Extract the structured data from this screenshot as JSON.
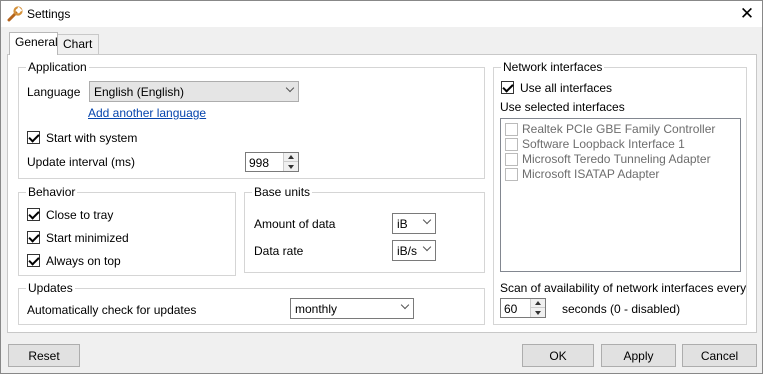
{
  "window": {
    "title": "Settings",
    "close_glyph": "✕"
  },
  "tabs": [
    {
      "label": "General",
      "active": true
    },
    {
      "label": "Chart",
      "active": false
    }
  ],
  "application": {
    "group_label": "Application",
    "language_label": "Language",
    "language_value": "English (English)",
    "add_language_link": "Add another language",
    "start_with_system_label": "Start with system",
    "start_with_system_checked": true,
    "update_interval_label": "Update interval (ms)",
    "update_interval_value": "998"
  },
  "behavior": {
    "group_label": "Behavior",
    "items": [
      {
        "label": "Close to tray",
        "checked": true
      },
      {
        "label": "Start minimized",
        "checked": true
      },
      {
        "label": "Always on top",
        "checked": true
      }
    ]
  },
  "base_units": {
    "group_label": "Base units",
    "amount_label": "Amount of data",
    "amount_value": "iB",
    "rate_label": "Data rate",
    "rate_value": "iB/s"
  },
  "updates": {
    "group_label": "Updates",
    "check_label": "Automatically check for updates",
    "check_value": "monthly"
  },
  "network": {
    "group_label": "Network interfaces",
    "use_all_label": "Use all interfaces",
    "use_all_checked": true,
    "use_selected_label": "Use selected interfaces",
    "interfaces": [
      {
        "name": "Realtek PCIe GBE Family Controller",
        "checked": false
      },
      {
        "name": "Software Loopback Interface 1",
        "checked": false
      },
      {
        "name": "Microsoft Teredo Tunneling Adapter",
        "checked": false
      },
      {
        "name": "Microsoft ISATAP Adapter",
        "checked": false
      }
    ],
    "scan_label": "Scan of availability of network interfaces every",
    "scan_value": "60",
    "scan_unit": "seconds (0 - disabled)"
  },
  "buttons": {
    "reset": "Reset",
    "ok": "OK",
    "apply": "Apply",
    "cancel": "Cancel"
  },
  "icons": {
    "title": "wrench-icon",
    "close": "close-icon"
  }
}
